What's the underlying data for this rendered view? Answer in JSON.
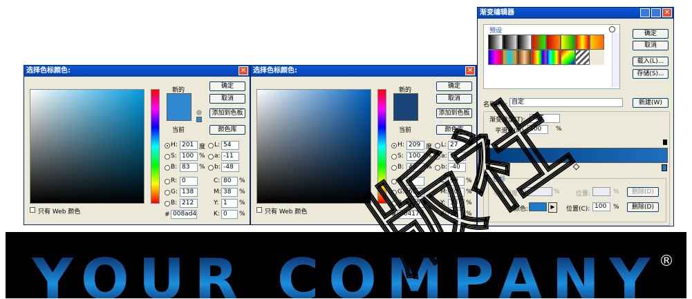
{
  "dialog1": {
    "title": "选择色标颜色:",
    "new_label": "新的",
    "current_label": "当前",
    "new_color": "#2f88d0",
    "current_color": "#2f88d0",
    "buttons": {
      "ok": "确定",
      "cancel": "取消",
      "add_swatch": "添加到色板",
      "libraries": "颜色库"
    },
    "hsb": {
      "h_label": "H:",
      "h": "201",
      "h_unit": "度",
      "s_label": "S:",
      "s": "100",
      "s_unit": "%",
      "b_label": "B:",
      "b": "83",
      "b_unit": "%"
    },
    "rgb": {
      "r_label": "R:",
      "r": "0",
      "g_label": "G:",
      "g": "138",
      "b_label": "B:",
      "b": "212"
    },
    "lab": {
      "l_label": "L:",
      "l": "54",
      "a_label": "a:",
      "a": "-11",
      "b_label": "b:",
      "b": "-48"
    },
    "cmyk": {
      "c_label": "C:",
      "c": "80",
      "m_label": "M:",
      "m": "38",
      "y_label": "Y:",
      "y": "1",
      "k_label": "K:",
      "k": "0",
      "unit": "%"
    },
    "hex_label": "#",
    "hex": "008ad4",
    "web_only": "只有 Web 颜色"
  },
  "dialog2": {
    "title": "选择色标颜色:",
    "new_label": "新的",
    "current_label": "当前",
    "new_color": "#184478",
    "current_color": "#184478",
    "buttons": {
      "ok": "确定",
      "cancel": "取消",
      "add_swatch": "添加到色板",
      "libraries": "颜色库"
    },
    "hsb": {
      "h_label": "H:",
      "h": "209",
      "h_unit": "度",
      "s_label": "S:",
      "s": "100",
      "s_unit": "%",
      "b_label": "B:",
      "b": "49",
      "b_unit": "%"
    },
    "rgb": {
      "r_label": "R:",
      "r": "0",
      "g_label": "G:",
      "g": "65",
      "b_label": "B:",
      "b": "125"
    },
    "lab": {
      "l_label": "L:",
      "l": "27",
      "a_label": "a:",
      "a": "1",
      "b_label": "b:",
      "b": "-40"
    },
    "cmyk": {
      "c_label": "C:",
      "c": "99",
      "m_label": "M:",
      "m": "80",
      "y_label": "Y:",
      "y": "33",
      "k_label": "K:",
      "k": "1",
      "unit": "%"
    },
    "hex_label": "#",
    "hex": "00417d",
    "web_only": "只有 Web 颜色"
  },
  "gradient_editor": {
    "title": "渐变编辑器",
    "presets_label": "预设",
    "buttons": {
      "ok": "确定",
      "cancel": "取消",
      "load": "载入(L)...",
      "save": "存储(S)...",
      "new": "新建(W)"
    },
    "name_label": "名称(N):",
    "name_value": "自定",
    "type_label": "渐变类型(T):",
    "type_value": "实底",
    "smooth_label": "平滑度(M):",
    "smooth_value": "100",
    "smooth_unit": "%",
    "stops_label": "色标",
    "opacity_label": "不透明度:",
    "opacity_unit": "%",
    "position_label": "位置:",
    "position_unit": "%",
    "delete_label": "删除(D)",
    "color_label": "颜色:",
    "color_position_label": "位置(C):",
    "color_position_value": "100",
    "color_position_unit": "%",
    "stop_color": "#1e78c8"
  },
  "logo": {
    "text": "YOUR COMPANY",
    "mark": "®"
  },
  "watermark": "版社",
  "colors": {
    "accent_blue": "#1a74c4",
    "title_blue": "#0a58d8"
  }
}
